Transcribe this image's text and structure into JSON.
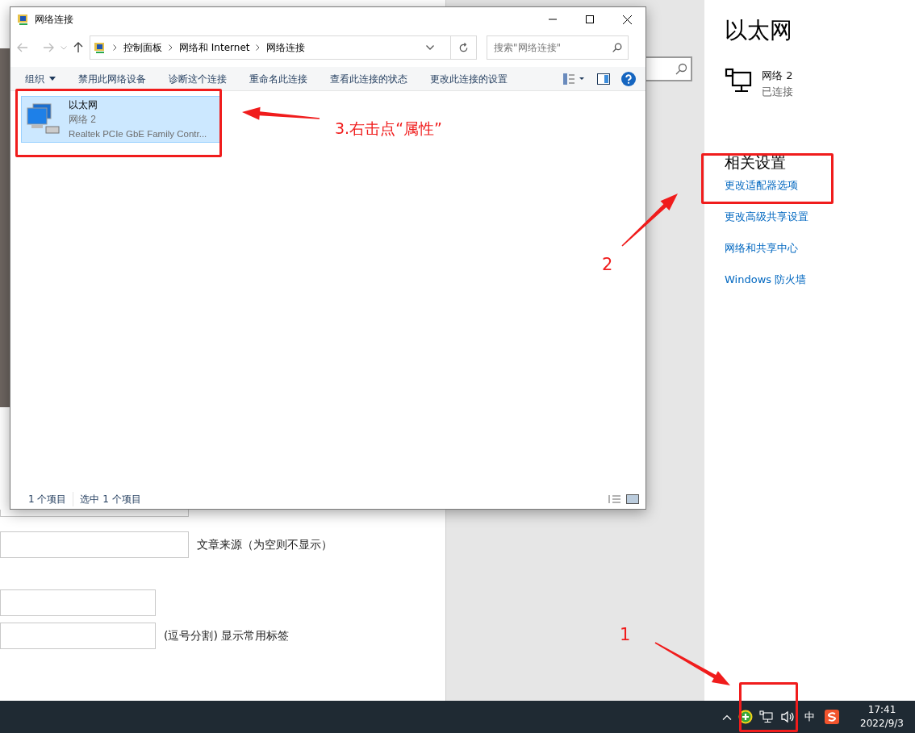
{
  "explorer": {
    "title": "网络连接",
    "breadcrumb": [
      "控制面板",
      "网络和 Internet",
      "网络连接"
    ],
    "search": {
      "placeholder": "搜索\"网络连接\""
    },
    "commands": [
      {
        "label": "组织",
        "kind": "menu"
      },
      {
        "label": "禁用此网络设备",
        "kind": "command"
      },
      {
        "label": "诊断这个连接",
        "kind": "command"
      },
      {
        "label": "重命名此连接",
        "kind": "command"
      },
      {
        "label": "查看此连接的状态",
        "kind": "command"
      },
      {
        "label": "更改此连接的设置",
        "kind": "command"
      }
    ],
    "items": [
      {
        "name": "以太网",
        "network": "网络 2",
        "adapter": "Realtek PCIe GbE Family Contr...",
        "selected": true
      }
    ],
    "status_bar": [
      "1 个项目",
      "选中 1 个项目"
    ]
  },
  "settings": {
    "title": "以太网",
    "network": {
      "name": "网络 2",
      "status": "已连接"
    },
    "related_heading": "相关设置",
    "links": [
      "更改适配器选项",
      "更改高级共享设置",
      "网络和共享中心",
      "Windows 防火墙"
    ]
  },
  "form_rows": [
    {
      "kind": "field"
    },
    {
      "kind": "field",
      "label": "文章来源（为空则不显示）"
    },
    {
      "kind": "field"
    },
    {
      "kind": "field",
      "label": "(逗号分割) 显示常用标签"
    }
  ],
  "taskbar": {
    "ime": "中",
    "time": "17:41",
    "date": "2022/9/3"
  },
  "annotations": [
    {
      "kind": "note",
      "text": "3.右击点“属性”"
    },
    {
      "kind": "note",
      "text": "2"
    },
    {
      "kind": "note",
      "text": "1"
    }
  ]
}
